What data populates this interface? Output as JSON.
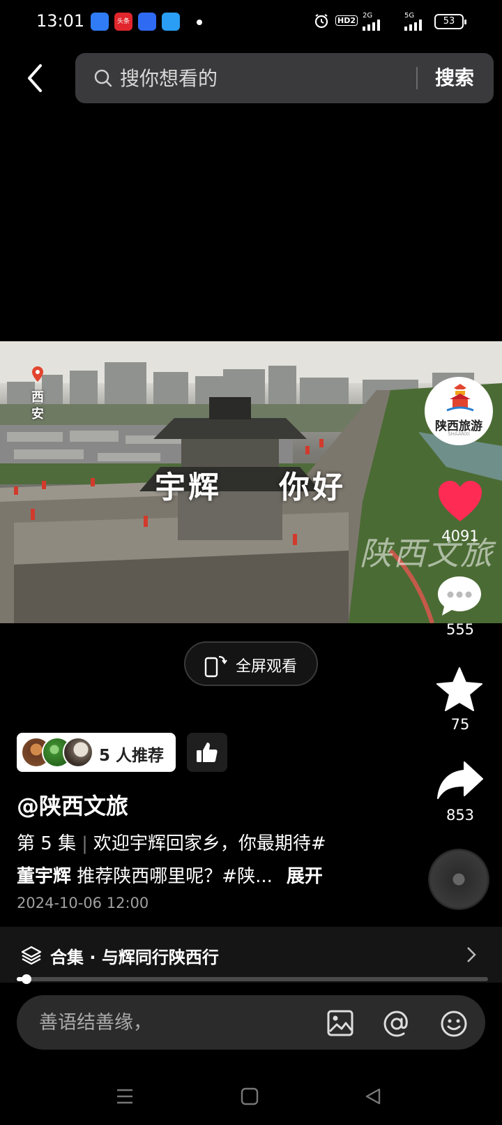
{
  "status_bar": {
    "time": "13:01",
    "apps": [
      {
        "icon": "browser-icon",
        "label": ""
      },
      {
        "icon": "toutiao-icon",
        "label": "头条"
      },
      {
        "icon": "baidu-icon",
        "label": ""
      },
      {
        "icon": "search-app-icon",
        "label": ""
      }
    ],
    "hd": "HD2",
    "net1": "2G",
    "net2": "5G",
    "battery": "53"
  },
  "search": {
    "placeholder": "搜你想看的",
    "button": "搜索"
  },
  "video": {
    "location": "西安",
    "title_left": "宇辉",
    "title_right": "你好",
    "watermark": "陕西文旅"
  },
  "fullscreen": {
    "label": "全屏观看"
  },
  "rail": {
    "avatar_text": "陕西旅游",
    "avatar_sub": "SHAANXI",
    "likes": "4091",
    "comments": "555",
    "favorites": "75",
    "shares": "853"
  },
  "recommend": {
    "label": "5 人推荐"
  },
  "post": {
    "author": "@陕西文旅",
    "episode": "第 5 集",
    "text1": "欢迎宇辉回家乡，你最期待#",
    "text2_bold": "董宇辉",
    "text2": " 推荐陕西哪里呢？#陕...",
    "more": "展开",
    "date": "2024-10-06 12:00"
  },
  "collection": {
    "label": "合集 · 与辉同行陕西行"
  },
  "playback": {
    "progress": 0.014
  },
  "comment_bar": {
    "placeholder": "善语结善缘，"
  },
  "colors": {
    "background": "#000000",
    "like_heart": "#fe2c55",
    "search_bg": "#3a3a3c"
  }
}
